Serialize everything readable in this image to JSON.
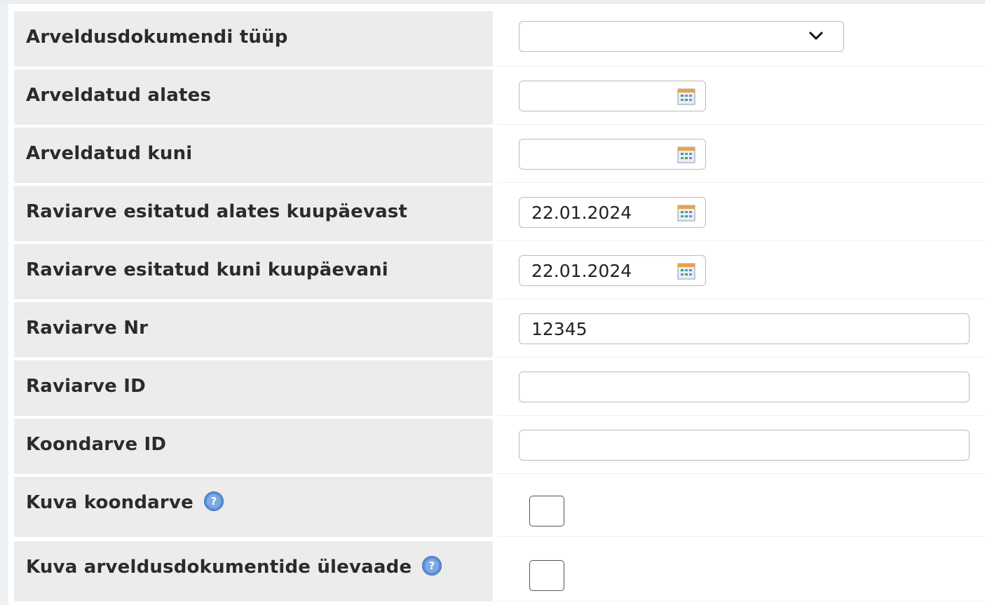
{
  "form": {
    "rows": [
      {
        "label": "Arveldusdokumendi tüüp",
        "value": ""
      },
      {
        "label": "Arveldatud alates",
        "value": ""
      },
      {
        "label": "Arveldatud kuni",
        "value": ""
      },
      {
        "label": "Raviarve esitatud alates kuupäevast",
        "value": "22.01.2024"
      },
      {
        "label": "Raviarve esitatud kuni kuupäevani",
        "value": "22.01.2024"
      },
      {
        "label": "Raviarve Nr",
        "value": "12345"
      },
      {
        "label": "Raviarve ID",
        "value": ""
      },
      {
        "label": "Koondarve ID",
        "value": ""
      },
      {
        "label": "Kuva koondarve",
        "checked": false
      },
      {
        "label": "Kuva arveldusdokumentide ülevaade",
        "checked": false
      }
    ]
  },
  "icons": {
    "dropdown": "chevron-down-icon",
    "calendar": "calendar-icon",
    "help": "help-icon"
  },
  "colors": {
    "label_bg": "#ececec",
    "help_icon": "#5b8fd6",
    "calendar_green": "#3aa757",
    "calendar_orange": "#e9a24c"
  }
}
